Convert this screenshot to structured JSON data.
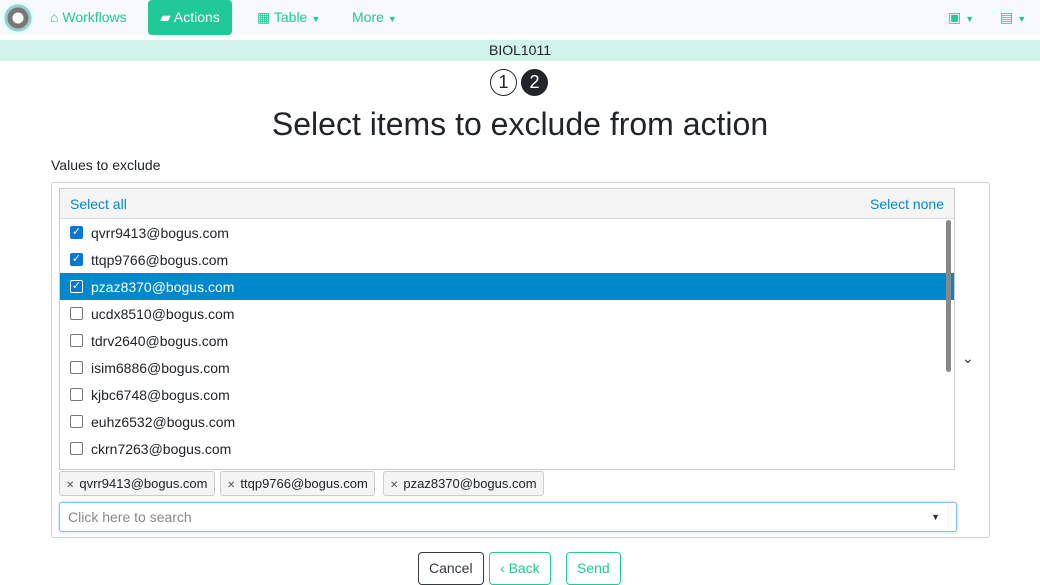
{
  "nav": {
    "workflows": "Workflows",
    "actions": "Actions",
    "table": "Table",
    "more": "More"
  },
  "course": "BIOL1011",
  "steps": [
    "1",
    "2"
  ],
  "title": "Select items to exclude from action",
  "label": "Values to exclude",
  "list": {
    "select_all": "Select all",
    "select_none": "Select none",
    "items": [
      {
        "email": "qvrr9413@bogus.com",
        "checked": true
      },
      {
        "email": "ttqp9766@bogus.com",
        "checked": true
      },
      {
        "email": "pzaz8370@bogus.com",
        "checked": true
      },
      {
        "email": "ucdx8510@bogus.com",
        "checked": false
      },
      {
        "email": "tdrv2640@bogus.com",
        "checked": false
      },
      {
        "email": "isim6886@bogus.com",
        "checked": false
      },
      {
        "email": "kjbc6748@bogus.com",
        "checked": false
      },
      {
        "email": "euhz6532@bogus.com",
        "checked": false
      },
      {
        "email": "ckrn7263@bogus.com",
        "checked": false
      }
    ]
  },
  "tags": [
    "qvrr9413@bogus.com",
    "ttqp9766@bogus.com",
    "pzaz8370@bogus.com"
  ],
  "search_placeholder": "Click here to search",
  "buttons": {
    "cancel": "Cancel",
    "back": "Back",
    "send": "Send"
  },
  "colors": {
    "accent": "#20c997",
    "selected": "#0088cc"
  }
}
